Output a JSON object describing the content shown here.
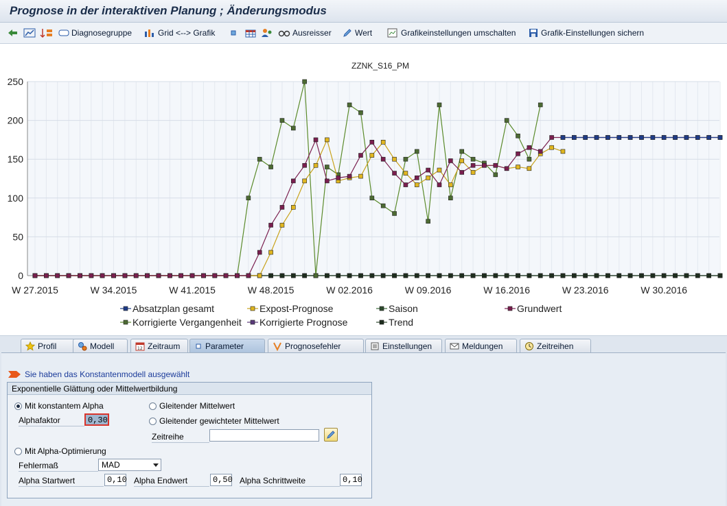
{
  "window": {
    "title": "Prognose in der interaktiven Planung  ; Änderungsmodus"
  },
  "toolbar": {
    "diagnosegruppe": "Diagnosegruppe",
    "grid_grafik": "Grid <--> Grafik",
    "ausreisser": "Ausreisser",
    "wert": "Wert",
    "grafikeinstellungen_umschalten": "Grafikeinstellungen umschalten",
    "grafik_einstellungen_sichern": "Grafik-Einstellungen sichern"
  },
  "chart_data": {
    "type": "line",
    "title": "ZZNK_S16_PM",
    "ylim": [
      0,
      250
    ],
    "y_ticks": [
      0,
      50,
      100,
      150,
      200,
      250
    ],
    "x_tick_labels": [
      "W 27.2015",
      "W 34.2015",
      "W 41.2015",
      "W 48.2015",
      "W 02.2016",
      "W 09.2016",
      "W 16.2016",
      "W 23.2016",
      "W 30.2016"
    ],
    "x_tick_index": [
      0,
      7,
      14,
      21,
      28,
      35,
      42,
      49,
      56
    ],
    "grid": true,
    "legend_position": "bottom",
    "series": [
      {
        "name": "Absatzplan gesamt",
        "color": "#1f3c88",
        "marker": "#1f3c88",
        "values": [
          null,
          null,
          null,
          null,
          null,
          null,
          null,
          null,
          null,
          null,
          null,
          null,
          null,
          null,
          null,
          null,
          null,
          null,
          null,
          null,
          null,
          null,
          null,
          null,
          null,
          null,
          null,
          null,
          null,
          null,
          null,
          null,
          null,
          null,
          null,
          null,
          null,
          null,
          null,
          null,
          null,
          null,
          null,
          null,
          null,
          null,
          null,
          178,
          178,
          178,
          178,
          178,
          178,
          178,
          178,
          178,
          178,
          178,
          178,
          178,
          178,
          178
        ]
      },
      {
        "name": "Expost-Prognose",
        "color": "#c8a21a",
        "marker": "#e0b620",
        "values": [
          0,
          0,
          0,
          0,
          0,
          0,
          0,
          0,
          0,
          0,
          0,
          0,
          0,
          0,
          0,
          0,
          0,
          0,
          0,
          0,
          0,
          30,
          65,
          88,
          122,
          142,
          175,
          122,
          126,
          128,
          155,
          172,
          150,
          132,
          117,
          126,
          136,
          117,
          148,
          133,
          142,
          142,
          138,
          140,
          138,
          157,
          165,
          160,
          null,
          null,
          null,
          null,
          null,
          null,
          null,
          null,
          null,
          null,
          null,
          null,
          null,
          null
        ]
      },
      {
        "name": "Saison",
        "color": "#3b6b3b",
        "marker": "#2e4a2e",
        "values": [
          0,
          0,
          0,
          0,
          0,
          0,
          0,
          0,
          0,
          0,
          0,
          0,
          0,
          0,
          0,
          0,
          0,
          0,
          0,
          0,
          0,
          0,
          0,
          0,
          0,
          0,
          0,
          0,
          0,
          0,
          0,
          0,
          0,
          0,
          0,
          0,
          0,
          0,
          0,
          0,
          0,
          0,
          0,
          0,
          0,
          0,
          0,
          0,
          0,
          0,
          0,
          0,
          0,
          0,
          0,
          0,
          0,
          0,
          0,
          0,
          0,
          0
        ]
      },
      {
        "name": "Grundwert",
        "color": "#7a1f4f",
        "marker": "#7a1f4f",
        "values": [
          0,
          0,
          0,
          0,
          0,
          0,
          0,
          0,
          0,
          0,
          0,
          0,
          0,
          0,
          0,
          0,
          0,
          0,
          0,
          0,
          30,
          65,
          88,
          122,
          142,
          175,
          122,
          126,
          128,
          155,
          172,
          150,
          132,
          117,
          126,
          136,
          117,
          148,
          133,
          142,
          142,
          142,
          138,
          157,
          165,
          160,
          178,
          178,
          178,
          178,
          178,
          178,
          178,
          178,
          178,
          178,
          178,
          178,
          178,
          178,
          178,
          178
        ]
      },
      {
        "name": "Korrigierte Vergangenheit",
        "color": "#5a8a2a",
        "marker": "#4d6b33",
        "values": [
          0,
          0,
          0,
          0,
          0,
          0,
          0,
          0,
          0,
          0,
          0,
          0,
          0,
          0,
          0,
          0,
          0,
          0,
          0,
          100,
          150,
          140,
          200,
          190,
          250,
          0,
          140,
          130,
          220,
          210,
          100,
          90,
          80,
          150,
          160,
          70,
          220,
          100,
          160,
          150,
          145,
          130,
          200,
          180,
          150,
          220,
          null,
          null,
          null,
          null,
          null,
          null,
          null,
          null,
          null,
          null,
          null,
          null,
          null,
          null,
          null,
          null
        ]
      },
      {
        "name": "Korrigierte Prognose",
        "color": "#5a3b7a",
        "marker": "#5a3b7a",
        "values": [
          0,
          0,
          0,
          0,
          0,
          0,
          0,
          0,
          0,
          0,
          0,
          0,
          0,
          0,
          0,
          0,
          0,
          0,
          0,
          0,
          0,
          0,
          0,
          0,
          0,
          0,
          0,
          0,
          0,
          0,
          0,
          0,
          0,
          0,
          0,
          0,
          0,
          0,
          0,
          0,
          0,
          0,
          0,
          0,
          0,
          0,
          0,
          0,
          0,
          0,
          0,
          0,
          0,
          0,
          0,
          0,
          0,
          0,
          0,
          0,
          0,
          0
        ]
      },
      {
        "name": "Trend",
        "color": "#2e4a2e",
        "marker": "#1e2e1e",
        "values": [
          0,
          0,
          0,
          0,
          0,
          0,
          0,
          0,
          0,
          0,
          0,
          0,
          0,
          0,
          0,
          0,
          0,
          0,
          0,
          0,
          0,
          0,
          0,
          0,
          0,
          0,
          0,
          0,
          0,
          0,
          0,
          0,
          0,
          0,
          0,
          0,
          0,
          0,
          0,
          0,
          0,
          0,
          0,
          0,
          0,
          0,
          0,
          0,
          0,
          0,
          0,
          0,
          0,
          0,
          0,
          0,
          0,
          0,
          0,
          0,
          0,
          0
        ]
      }
    ]
  },
  "tabs": [
    {
      "label": "Profil",
      "icon": "star-icon",
      "active": false
    },
    {
      "label": "Modell",
      "icon": "gears-icon",
      "active": false
    },
    {
      "label": "Zeitraum",
      "icon": "calendar-icon",
      "active": false
    },
    {
      "label": "Parameter",
      "icon": "square-icon",
      "active": true
    },
    {
      "label": "Prognosefehler",
      "icon": "error-icon",
      "active": false
    },
    {
      "label": "Einstellungen",
      "icon": "list-icon",
      "active": false
    },
    {
      "label": "Meldungen",
      "icon": "messages-icon",
      "active": false
    },
    {
      "label": "Zeitreihen",
      "icon": "clock-icon",
      "active": false
    }
  ],
  "panel": {
    "info_message": "Sie haben das Konstantenmodell ausgewählt",
    "group_title": "Exponentielle Glättung oder Mittelwertbildung",
    "radio_konstant": "Mit konstantem Alpha",
    "radio_gleitend": "Gleitender Mittelwert",
    "radio_gewichtet": "Gleitender gewichteter Mittelwert",
    "radio_optimierung": "Mit Alpha-Optimierung",
    "alphafaktor_label": "Alphafaktor",
    "alphafaktor_value": "0,30",
    "zeitreihe_label": "Zeitreihe",
    "zeitreihe_value": "",
    "fehlermass_label": "Fehlermaß",
    "fehlermass_value": "MAD",
    "alpha_start_label": "Alpha Startwert",
    "alpha_start_value": "0,10",
    "alpha_end_label": "Alpha Endwert",
    "alpha_end_value": "0,50",
    "alpha_step_label": "Alpha Schrittweite",
    "alpha_step_value": "0,10"
  }
}
